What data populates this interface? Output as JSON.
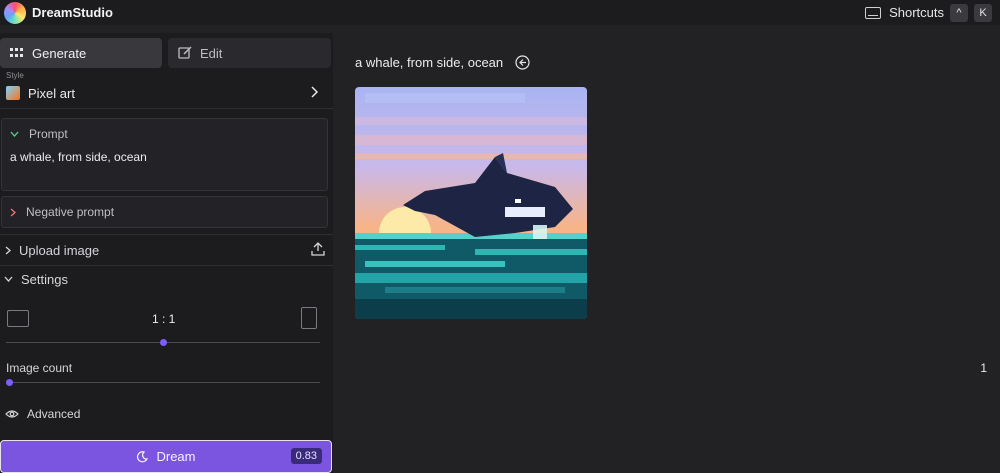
{
  "app": {
    "title": "DreamStudio"
  },
  "topbar": {
    "shortcuts_label": "Shortcuts",
    "key1": "^",
    "key2": "K"
  },
  "tabs": {
    "generate": "Generate",
    "edit": "Edit"
  },
  "style": {
    "label": "Style",
    "value": "Pixel art"
  },
  "prompt": {
    "header": "Prompt",
    "text": "a whale, from side, ocean"
  },
  "negative_prompt": {
    "header": "Negative prompt"
  },
  "upload": {
    "label": "Upload image"
  },
  "settings": {
    "label": "Settings",
    "aspect_ratio": "1 : 1",
    "aspect_slider_value": 0.5,
    "image_count_label": "Image count",
    "image_count_value": "1",
    "image_count_slider_value": 0,
    "advanced_label": "Advanced"
  },
  "dream": {
    "label": "Dream",
    "cost": "0.83"
  },
  "result": {
    "prompt": "a whale, from side, ocean"
  },
  "colors": {
    "accent": "#7b55e0",
    "background": "#222225",
    "panel": "#1c1c1f"
  }
}
